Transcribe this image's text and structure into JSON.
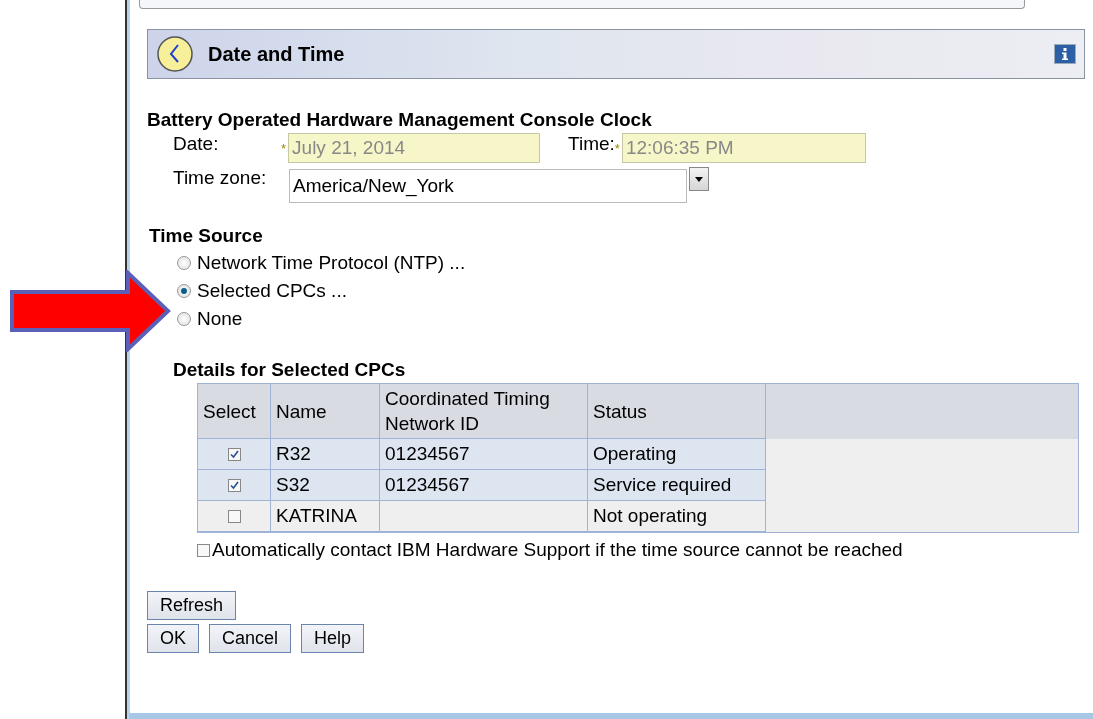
{
  "panel": {
    "title": "Date and Time"
  },
  "clock": {
    "heading": "Battery Operated Hardware Management Console Clock",
    "date_label": "Date:",
    "date_required": "*",
    "date_value": "July 21, 2014",
    "time_label": "Time:",
    "time_required": "*",
    "time_value": "12:06:35 PM",
    "timezone_label": "Time zone:",
    "timezone_value": "America/New_York"
  },
  "time_source": {
    "heading": "Time Source",
    "options": [
      {
        "label": "Network Time Protocol (NTP) ...",
        "selected": false
      },
      {
        "label": "Selected CPCs ...",
        "selected": true
      },
      {
        "label": "None",
        "selected": false
      }
    ]
  },
  "details": {
    "heading": "Details for Selected CPCs",
    "columns": [
      "Select",
      "Name",
      "Coordinated Timing Network ID",
      "Status"
    ],
    "rows": [
      {
        "checked": true,
        "name": "R32",
        "network_id": "01234567",
        "status": "Operating"
      },
      {
        "checked": true,
        "name": "S32",
        "network_id": "01234567",
        "status": "Service required"
      },
      {
        "checked": false,
        "name": "KATRINA",
        "status": "Not operating"
      }
    ]
  },
  "auto_contact": {
    "label": "Automatically contact IBM Hardware Support if the time source cannot be reached",
    "checked": false
  },
  "refresh_button": {
    "label": "Refresh"
  },
  "dialog_buttons": [
    "OK",
    "Cancel",
    "Help"
  ]
}
